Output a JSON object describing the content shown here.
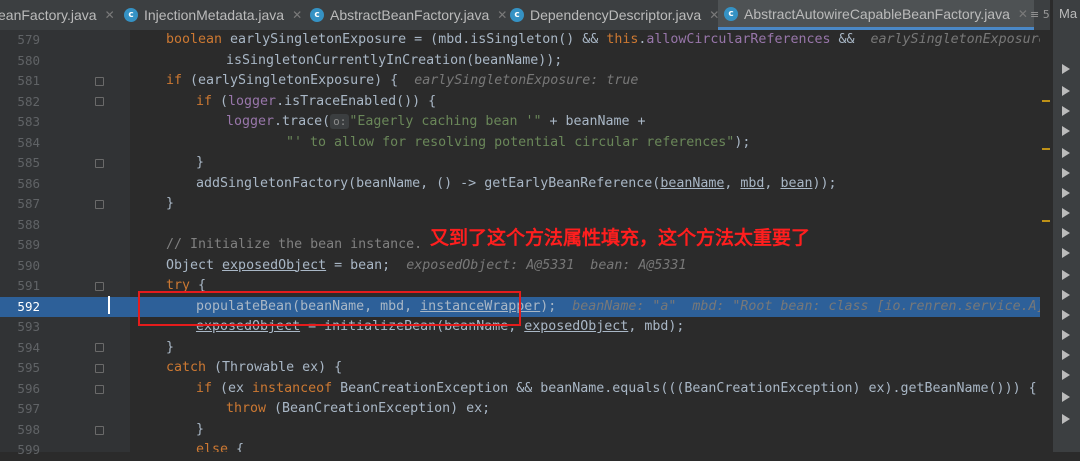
{
  "tabs": [
    {
      "label": "eanFactory.java",
      "active": false,
      "icon": "java-class-icon"
    },
    {
      "label": "InjectionMetadata.java",
      "active": false,
      "icon": "java-class-icon"
    },
    {
      "label": "AbstractBeanFactory.java",
      "active": false,
      "icon": "java-class-icon"
    },
    {
      "label": "DependencyDescriptor.java",
      "active": false,
      "icon": "java-class-icon"
    },
    {
      "label": "AbstractAutowireCapableBeanFactory.java",
      "active": true,
      "icon": "java-class-icon"
    }
  ],
  "tab_overflow": "≡ 5",
  "right_panel_label": "Ma",
  "annotation": "又到了这个方法属性填充，这个方法太重要了",
  "current_line": "592",
  "lines": [
    {
      "num": "579"
    },
    {
      "num": "580"
    },
    {
      "num": "581"
    },
    {
      "num": "582"
    },
    {
      "num": "583"
    },
    {
      "num": "584"
    },
    {
      "num": "585"
    },
    {
      "num": "586"
    },
    {
      "num": "587"
    },
    {
      "num": "588"
    },
    {
      "num": "589"
    },
    {
      "num": "590"
    },
    {
      "num": "591"
    },
    {
      "num": "592"
    },
    {
      "num": "593"
    },
    {
      "num": "594"
    },
    {
      "num": "595"
    },
    {
      "num": "596"
    },
    {
      "num": "597"
    },
    {
      "num": "598"
    },
    {
      "num": "599"
    }
  ],
  "code": {
    "l579": {
      "kw": "boolean",
      "a": " earlySingletonExposure = (mbd.isSingleton() && ",
      "this": "this",
      "dot": ".",
      "field": "allowCircularReferences",
      "b": " &&",
      "hint": "earlySingletonExposure: true"
    },
    "l580": {
      "a": "isSingletonCurrentlyInCreation(beanName));"
    },
    "l581": {
      "kw": "if",
      "a": " (earlySingletonExposure) {",
      "hint": "earlySingletonExposure: true"
    },
    "l582": {
      "kw": "if",
      "a": " (",
      "field": "logger",
      "b": ".isTraceEnabled()) {"
    },
    "l583": {
      "field": "logger",
      "a": ".trace(",
      "ph": "o:",
      "str": "\"Eagerly caching bean '\"",
      "b": " + beanName +"
    },
    "l584": {
      "str": "\"' to allow for resolving potential circular references\"",
      "a": ");"
    },
    "l585": {
      "a": "}"
    },
    "l586": {
      "a": "addSingletonFactory(beanName, () -> getEarlyBeanReference(",
      "u1": "beanName",
      "c1": ", ",
      "u2": "mbd",
      "c2": ", ",
      "u3": "bean",
      "b": "));"
    },
    "l587": {
      "a": "}"
    },
    "l589": {
      "cm": "// Initialize the bean instance."
    },
    "l590": {
      "a": "Object ",
      "u": "exposedObject",
      "b": " = bean;",
      "hint": "exposedObject: A@5331  bean: A@5331"
    },
    "l591": {
      "kw": "try",
      "a": " {"
    },
    "l592": {
      "a": "populateBean(beanName, mbd, ",
      "u": "instanceWrapper",
      "b": ");",
      "hint": "beanName: \"a\"  mbd: \"Root bean: class [io.renren.service.A]; scope=si"
    },
    "l593": {
      "u1": "exposedObject",
      "a": " = initializeBean(beanName, ",
      "u2": "exposedObject",
      "b": ", mbd);"
    },
    "l594": {
      "a": "}"
    },
    "l595": {
      "kw": "catch",
      "a": " (Throwable ex) {"
    },
    "l596": {
      "kw": "if",
      "a": " (ex ",
      "kw2": "instanceof",
      "b": " BeanCreationException && beanName.equals(((BeanCreationException) ex).getBeanName())) {"
    },
    "l597": {
      "kw": "throw",
      "a": " (BeanCreationException) ex;"
    },
    "l598": {
      "a": "}"
    },
    "l599": {
      "kw": "else",
      "a": " {"
    }
  },
  "colors": {
    "highlight": "#2d6099",
    "keyword": "#cc7832",
    "string": "#6a8759",
    "field": "#9876aa",
    "annotation": "#ff1e1e"
  }
}
